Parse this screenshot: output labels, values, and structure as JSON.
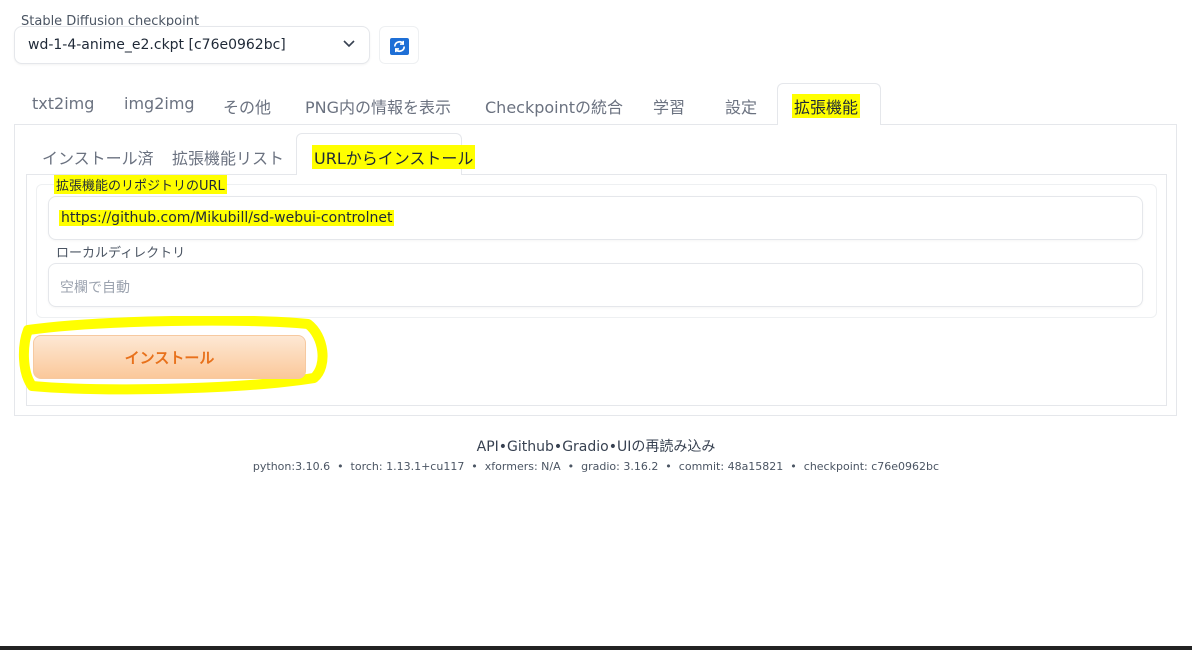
{
  "checkpoint": {
    "label": "Stable Diffusion checkpoint",
    "value": "wd-1-4-anime_e2.ckpt [c76e0962bc]"
  },
  "top_tabs": {
    "items": [
      "txt2img",
      "img2img",
      "その他",
      "PNG内の情報を表示",
      "Checkpointの統合",
      "学習",
      "設定",
      "拡張機能"
    ],
    "active": "拡張機能"
  },
  "sub_tabs": {
    "items": [
      "インストール済",
      "拡張機能リスト",
      "URLからインストール"
    ],
    "active": "URLからインストール"
  },
  "form": {
    "url_label": "拡張機能のリポジトリのURL",
    "url_value": "https://github.com/Mikubill/sd-webui-controlnet",
    "dir_label": "ローカルディレクトリ",
    "dir_placeholder": "空欄で自動",
    "install_label": "インストール"
  },
  "footer": {
    "links": [
      "API",
      "Github",
      "Gradio",
      "UIの再読み込み"
    ],
    "separator": "•",
    "versions": "python:3.10.6  •  torch: 1.13.1+cu117  •  xformers: N/A  •  gradio: 3.16.2  •  commit: 48a15821  •  checkpoint: c76e0962bc"
  },
  "colors": {
    "highlight": "#ffff00",
    "accent_orange": "#e8711b",
    "refresh_blue": "#1e6fd6"
  }
}
